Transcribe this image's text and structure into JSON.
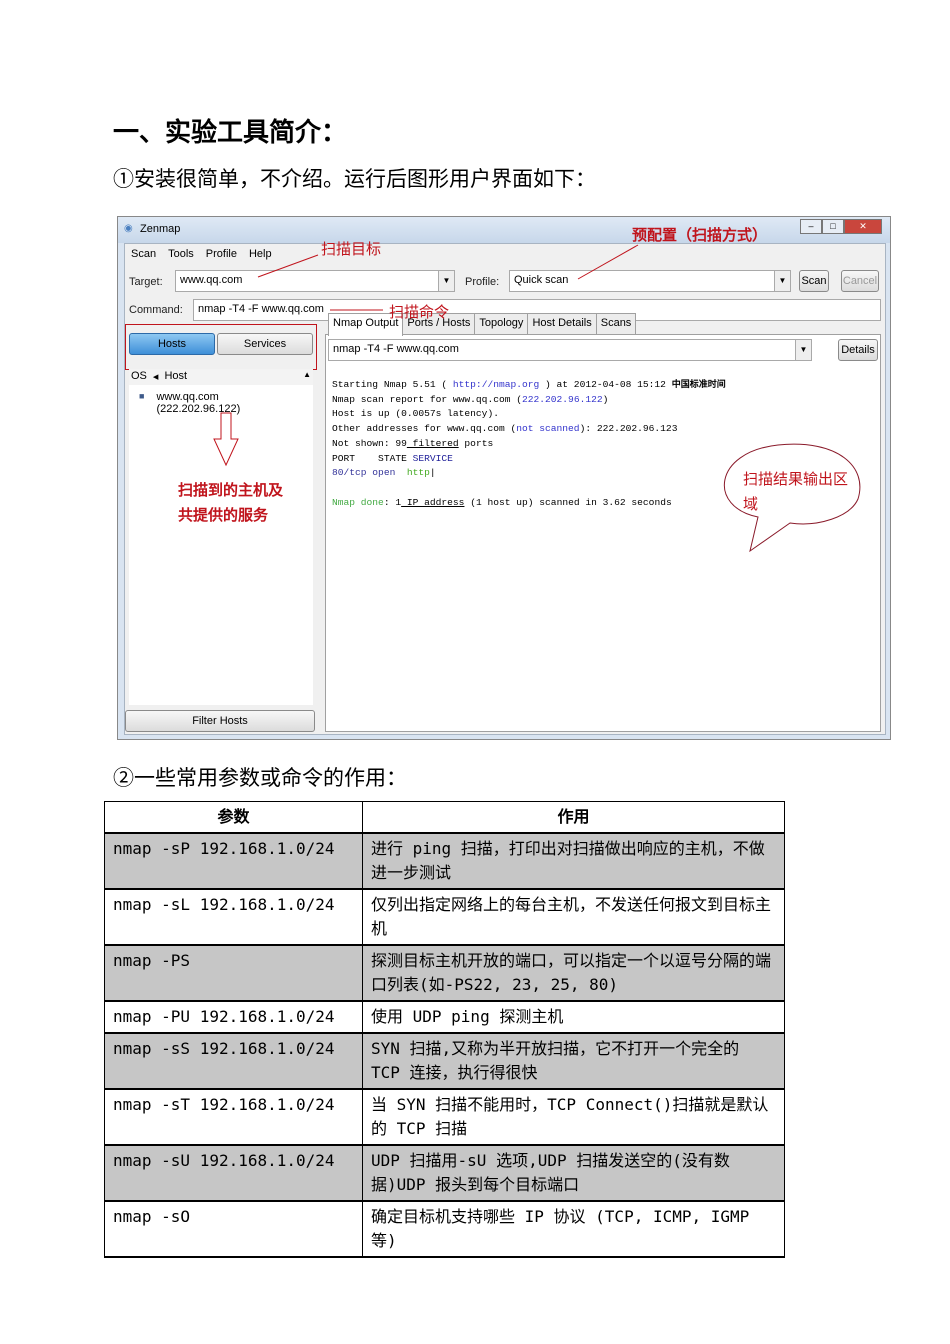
{
  "heading": "一、实验工具简介：",
  "intro": "①安装很简单，不介绍。运行后图形用户界面如下：",
  "zenmap": {
    "window_title": "Zenmap",
    "menu": [
      "Scan",
      "Tools",
      "Profile",
      "Help"
    ],
    "target_label": "Target:",
    "target_value": "www.qq.com",
    "profile_label": "Profile:",
    "profile_value": "Quick scan",
    "scan_button": "Scan",
    "cancel_button": "Cancel",
    "command_label": "Command:",
    "command_value": "nmap -T4 -F www.qq.com",
    "hosts_button": "Hosts",
    "services_button": "Services",
    "col_os": "OS",
    "col_host": "Host",
    "host_item": "www.qq.com (222.202.96.122)",
    "filter_hosts": "Filter Hosts",
    "tabs": [
      "Nmap Output",
      "Ports / Hosts",
      "Topology",
      "Host Details",
      "Scans"
    ],
    "output_command": "nmap -T4 -F www.qq.com",
    "details_button": "Details",
    "output": {
      "l1a": "Starting Nmap 5.51 ( ",
      "l1b": "http://nmap.org",
      "l1c": " ) at 2012-04-08 15:12 ",
      "l1d": "中国标准时间",
      "l2a": "Nmap scan report for www.qq.com (",
      "l2b": "222.202.96.122",
      "l2c": ")",
      "l3": "Host is up (0.0057s latency).",
      "l4a": "Other addresses for www.qq.com (",
      "l4b": "not scanned",
      "l4c": "): 222.202.96.123",
      "l5a": "Not shown: 99",
      "l5b": " filtered",
      "l5c": " ports",
      "l6a": "PORT    STATE ",
      "l6b": "SERVICE",
      "l7a": "80/tcp open  ",
      "l7b": "http",
      "l8a": "Nmap done",
      "l8b": ": 1",
      "l8c": " IP address",
      "l8d": " (1 host up) scanned in 3.62 seconds"
    },
    "annotations": {
      "target": "扫描目标",
      "profile": "预配置（扫描方式）",
      "command": "扫描命令",
      "hosts": "扫描到的主机及\n共提供的服务",
      "output": "扫描结果输出区\n域"
    }
  },
  "params_intro": "②一些常用参数或命令的作用：",
  "table": {
    "headers": [
      "参数",
      "作用"
    ],
    "rows": [
      {
        "param": "nmap -sP 192.168.1.0/24",
        "desc": "进行 ping 扫描，打印出对扫描做出响应的主机，不做进一步测试"
      },
      {
        "param": "nmap -sL 192.168.1.0/24",
        "desc": "仅列出指定网络上的每台主机，不发送任何报文到目标主机"
      },
      {
        "param": "nmap -PS",
        "desc": "探测目标主机开放的端口，可以指定一个以逗号分隔的端口列表(如-PS22, 23, 25, 80)"
      },
      {
        "param": "nmap -PU 192.168.1.0/24",
        "desc": "使用 UDP ping 探测主机"
      },
      {
        "param": "nmap -sS 192.168.1.0/24",
        "desc": "SYN 扫描,又称为半开放扫描，它不打开一个完全的 TCP 连接，执行得很快"
      },
      {
        "param": "nmap -sT 192.168.1.0/24",
        "desc": "当 SYN 扫描不能用时，TCP Connect()扫描就是默认的 TCP 扫描"
      },
      {
        "param": "nmap -sU 192.168.1.0/24",
        "desc": "UDP 扫描用-sU 选项,UDP 扫描发送空的(没有数据)UDP 报头到每个目标端口"
      },
      {
        "param": "nmap -sO",
        "desc": "确定目标机支持哪些 IP 协议 (TCP, ICMP, IGMP 等)"
      }
    ]
  }
}
